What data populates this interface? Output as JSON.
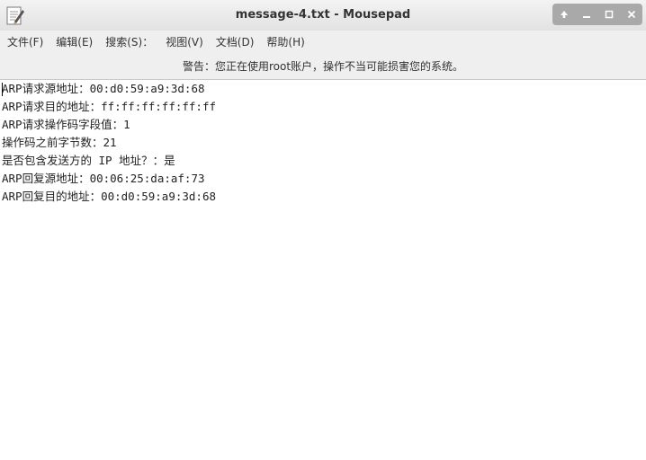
{
  "window": {
    "title": "message-4.txt - Mousepad",
    "app_icon": "text-editor-icon",
    "controls": [
      "keep-above-icon",
      "minimize-icon",
      "maximize-icon",
      "close-icon"
    ]
  },
  "menubar": {
    "file": "文件(F)",
    "edit": "编辑(E)",
    "search": "搜索(S)：",
    "view": "视图(V)",
    "document": "文档(D)",
    "help": "帮助(H)"
  },
  "warning": "警告：您正在使用root账户，操作不当可能损害您的系统。",
  "editor": {
    "lines": [
      "ARP请求源地址：00:d0:59:a9:3d:68",
      "ARP请求目的地址：ff:ff:ff:ff:ff:ff",
      "ARP请求操作码字段值：1",
      "操作码之前字节数：21",
      "是否包含发送方的 IP 地址？：是",
      "ARP回复源地址：00:06:25:da:af:73",
      "ARP回复目的地址：00:d0:59:a9:3d:68"
    ]
  },
  "colors": {
    "titlebar": "#e6e6e6",
    "menubar": "#efefef",
    "editor_bg": "#ffffff",
    "wm_group": "#a9a9a9"
  }
}
